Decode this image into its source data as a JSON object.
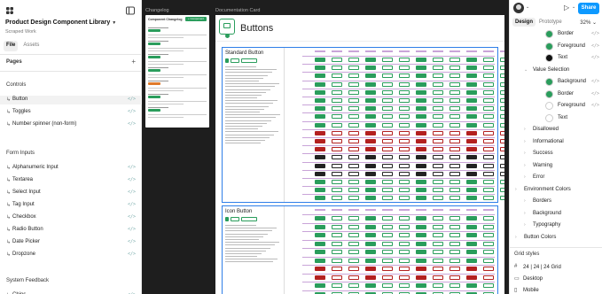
{
  "left_panel": {
    "project_title": "Product Design Component Library",
    "project_subtitle": "Scraped Work",
    "tabs": [
      "File",
      "Assets"
    ],
    "pages_label": "Pages",
    "sections": [
      {
        "label": "Controls",
        "items": [
          {
            "label": "Button",
            "selected": true
          },
          {
            "label": "Toggles",
            "selected": false
          },
          {
            "label": "Number spinner (non-form)",
            "selected": false
          }
        ]
      },
      {
        "label": "Form Inputs",
        "items": [
          {
            "label": "Alphanumeric Input",
            "selected": false
          },
          {
            "label": "Textarea",
            "selected": false
          },
          {
            "label": "Select Input",
            "selected": false
          },
          {
            "label": "Tag Input",
            "selected": false
          },
          {
            "label": "Checkbox",
            "selected": false
          },
          {
            "label": "Radio Button",
            "selected": false
          },
          {
            "label": "Date Picker",
            "selected": false
          },
          {
            "label": "Dropzone",
            "selected": false
          }
        ]
      },
      {
        "label": "System Feedback",
        "items": [
          {
            "label": "Chips",
            "selected": false
          }
        ]
      }
    ],
    "code_glyph": "</>"
  },
  "canvas": {
    "changelog_label": "Changelog",
    "changelog_title": "Component Changelog",
    "changelog_button": "+ Component",
    "doc_label": "Documentation Card",
    "doc_title": "Buttons",
    "sections": [
      {
        "title": "Standard Button"
      },
      {
        "title": "Icon Button"
      }
    ]
  },
  "right_panel": {
    "share_label": "Share",
    "tabs": [
      "Design",
      "Prototype"
    ],
    "zoom": "32%",
    "rows": [
      {
        "label": "Border",
        "swatch": "#2a9d5c",
        "indent": 2,
        "code": "</>"
      },
      {
        "label": "Foreground",
        "swatch": "#2a9d5c",
        "indent": 2,
        "code": "</>"
      },
      {
        "label": "Text",
        "swatch": "#111111",
        "indent": 2,
        "code": "</>"
      },
      {
        "label": "Value Selection",
        "swatch": null,
        "indent": 1,
        "caret": "⌄"
      },
      {
        "label": "Background",
        "swatch": "#2a9d5c",
        "indent": 2,
        "code": "</>"
      },
      {
        "label": "Border",
        "swatch": "#2a9d5c",
        "indent": 2,
        "code": "</>"
      },
      {
        "label": "Foreground",
        "swatch": "#ffffff",
        "indent": 2,
        "code": "</>"
      },
      {
        "label": "Text",
        "swatch": "#ffffff",
        "indent": 2,
        "code": ""
      },
      {
        "label": "Disallowed",
        "swatch": null,
        "indent": 1,
        "caret": "›"
      },
      {
        "label": "Informational",
        "swatch": null,
        "indent": 1,
        "caret": "›"
      },
      {
        "label": "Success",
        "swatch": null,
        "indent": 1,
        "caret": "›"
      },
      {
        "label": "Warning",
        "swatch": null,
        "indent": 1,
        "caret": "›"
      },
      {
        "label": "Error",
        "swatch": null,
        "indent": 1,
        "caret": "›"
      },
      {
        "label": "Environment Colors",
        "swatch": null,
        "indent": 0,
        "caret": "›"
      },
      {
        "label": "Borders",
        "swatch": null,
        "indent": 1,
        "caret": "›"
      },
      {
        "label": "Background",
        "swatch": null,
        "indent": 1,
        "caret": "›"
      },
      {
        "label": "Typography",
        "swatch": null,
        "indent": 1,
        "caret": "›"
      },
      {
        "label": "Button Colors",
        "swatch": null,
        "indent": 0,
        "caret": "›"
      }
    ],
    "grid_styles_label": "Grid styles",
    "grid_styles": [
      "24 | 24 | 24 Grid",
      "Desktop",
      "Mobile"
    ]
  }
}
